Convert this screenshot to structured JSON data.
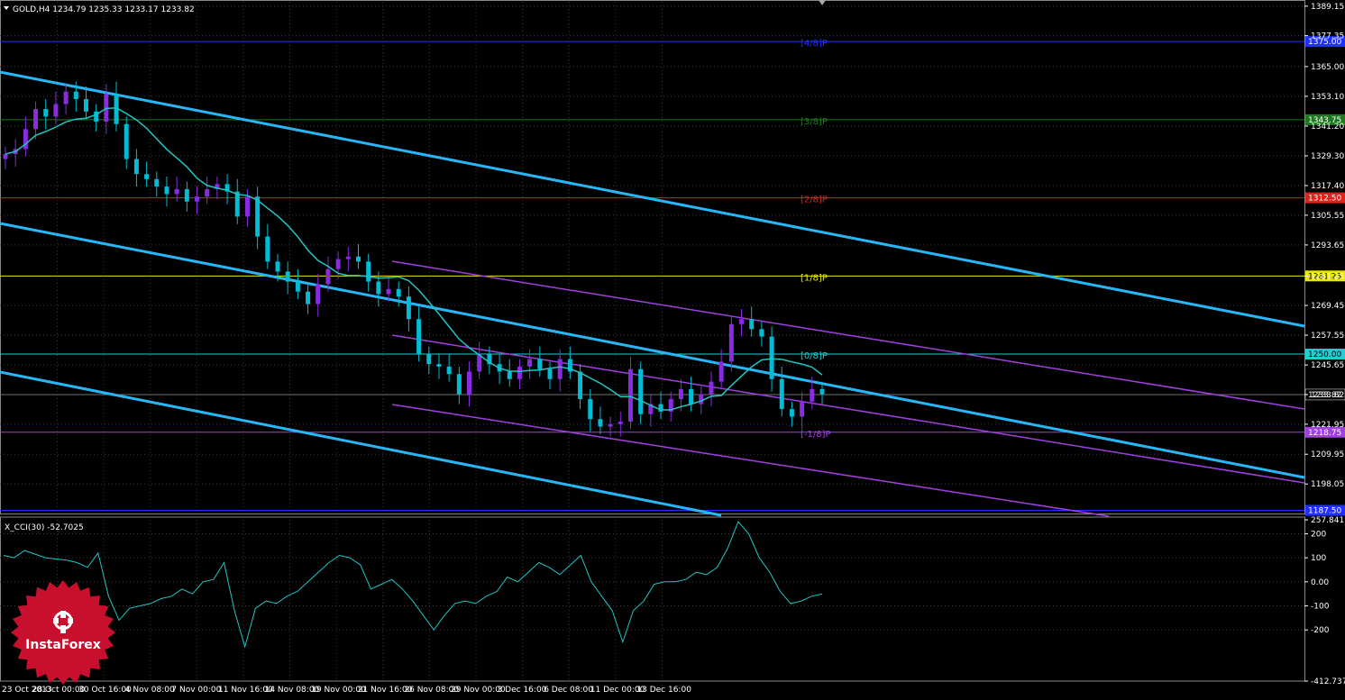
{
  "symbol_header": "GOLD,H4  1234.79 1235.33 1233.17 1233.82",
  "indicator_header": "X_CCI(30) -52.7025",
  "logo_text": "InstaForex",
  "colors": {
    "background": "#000000",
    "grid": "#3a3a3a",
    "bull_candle": "#8a2be2",
    "bear_candle": "#00bcd4",
    "moving_average": "#20c5c5",
    "main_channel": "#29b6f6",
    "inner_channel": "#a040e0",
    "cci_line": "#20c5c5",
    "logo": "#c8102e"
  },
  "chart_data": [
    {
      "type": "candlestick",
      "title": "GOLD,H4",
      "ohlc_last": {
        "open": 1234.79,
        "high": 1235.33,
        "low": 1233.17,
        "close": 1233.82
      },
      "ylim": [
        1186.6,
        1390.9
      ],
      "y_ticks": [
        "1389.15",
        "1377.35",
        "1365.00",
        "1353.10",
        "1341.20",
        "1329.30",
        "1317.40",
        "1305.55",
        "1293.65",
        "1281.25",
        "1269.45",
        "1257.55",
        "1245.65",
        "1233.82",
        "1221.95",
        "1209.95",
        "1198.05"
      ],
      "x_labels": [
        "23 Oct 2013",
        "28 Oct 00:00",
        "30 Oct 16:00",
        "4 Nov 08:00",
        "7 Nov 00:00",
        "11 Nov 16:00",
        "14 Nov 08:00",
        "19 Nov 00:00",
        "21 Nov 16:00",
        "26 Nov 08:00",
        "29 Nov 00:00",
        "3 Dec 16:00",
        "6 Dec 08:00",
        "11 Dec 00:00",
        "13 Dec 16:00"
      ],
      "murrey_levels": [
        {
          "label": "[4/8]P",
          "price": 1375.0,
          "price_label": "1375.00",
          "color": "#2030ff"
        },
        {
          "label": "[3/8]P",
          "price": 1343.75,
          "price_label": "1343.75",
          "color": "#1f7a1f"
        },
        {
          "label": "[2/8]P",
          "price": 1312.5,
          "price_label": "1312.50",
          "color": "#e0201a"
        },
        {
          "label": "[1/8]P",
          "price": 1281.25,
          "price_label": "1281.25",
          "color": "#e8e800"
        },
        {
          "label": "[0/8]P",
          "price": 1250.0,
          "price_label": "1250.00",
          "color": "#20d0d0"
        },
        {
          "label": "[-1/8]P",
          "price": 1218.75,
          "price_label": "1218.75",
          "color": "#a040e0"
        },
        {
          "label": "",
          "price": 1187.5,
          "price_label": "1187.50",
          "color": "#2030ff"
        }
      ],
      "current_price": {
        "price": 1233.82,
        "label": "1233.82"
      },
      "closes": [
        1330,
        1332,
        1340,
        1348,
        1345,
        1350,
        1355,
        1352,
        1347,
        1343,
        1354,
        1342,
        1328,
        1322,
        1320,
        1317,
        1314,
        1316,
        1311,
        1313,
        1316,
        1318,
        1315,
        1305,
        1313,
        1297,
        1287,
        1283,
        1279,
        1275,
        1270,
        1278,
        1284,
        1288,
        1289,
        1287,
        1279,
        1274,
        1276,
        1273,
        1264,
        1250,
        1246,
        1245,
        1242,
        1234,
        1243,
        1250,
        1246,
        1243,
        1240,
        1245,
        1248,
        1244,
        1240,
        1248,
        1243,
        1232,
        1224,
        1221,
        1222,
        1223,
        1244,
        1226,
        1230,
        1227,
        1232,
        1236,
        1230,
        1234,
        1239,
        1247,
        1262,
        1264,
        1260,
        1257,
        1240,
        1228,
        1225,
        1231,
        1236,
        1234
      ],
      "cci": {
        "ylim": [
          -412.7374,
          257.8411
        ],
        "y_ticks": [
          "257.8411",
          "200",
          "100",
          "0.00",
          "-100",
          "-200",
          "-412.7374"
        ],
        "values": [
          110,
          100,
          130,
          115,
          100,
          95,
          90,
          80,
          60,
          120,
          -60,
          -160,
          -110,
          -100,
          -90,
          -70,
          -60,
          -30,
          -50,
          0,
          10,
          80,
          -120,
          -270,
          -110,
          -80,
          -90,
          -60,
          -40,
          0,
          40,
          80,
          110,
          100,
          70,
          -30,
          -10,
          10,
          -30,
          -80,
          -140,
          -200,
          -140,
          -90,
          -80,
          -90,
          -60,
          -40,
          20,
          0,
          40,
          80,
          60,
          30,
          70,
          110,
          0,
          -60,
          -120,
          -250,
          -120,
          -80,
          -10,
          0,
          0,
          10,
          40,
          30,
          60,
          140,
          250,
          200,
          100,
          40,
          -40,
          -90,
          -80,
          -60,
          -50
        ]
      }
    }
  ]
}
